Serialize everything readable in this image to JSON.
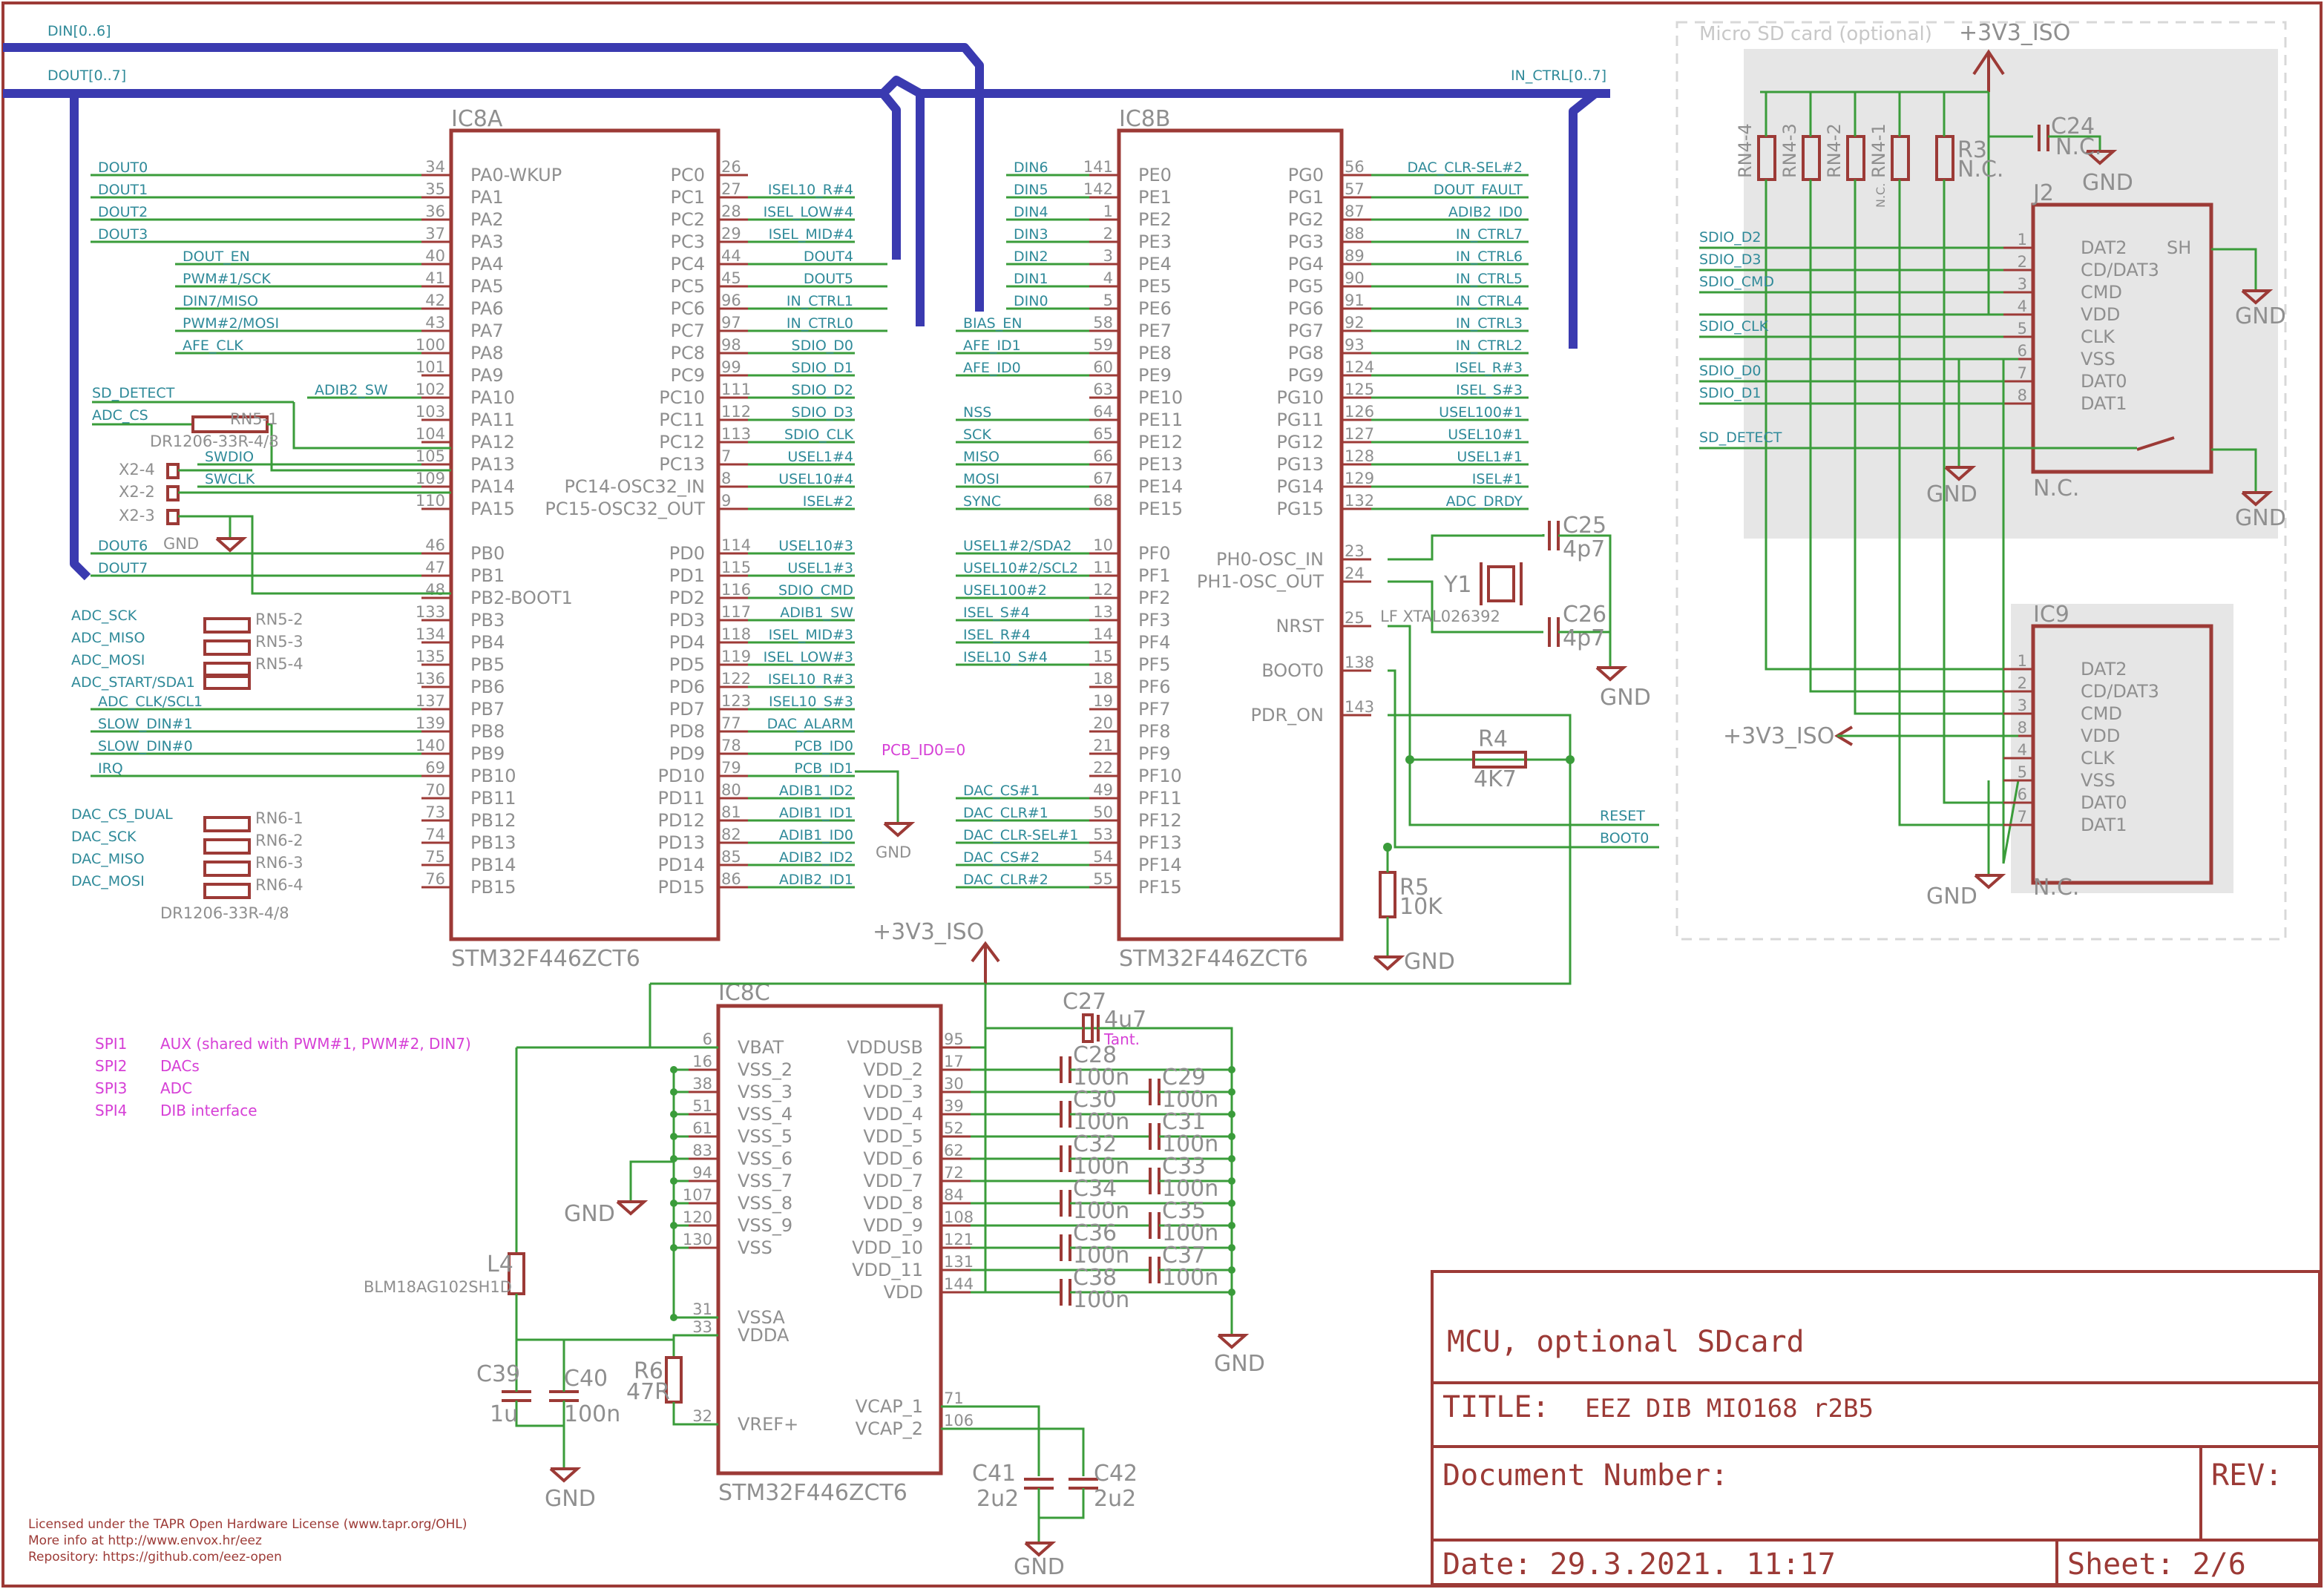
{
  "colors": {
    "frame": "#9c3a36",
    "wire": "#3a9c3a",
    "bus": "#3a3ab0",
    "signal": "#2f8a99",
    "label": "#8f8f8f",
    "note": "#d63fd6",
    "sdarea": "#e6e6e6"
  },
  "buses": {
    "din": "DIN[0..6]",
    "dout": "DOUT[0..7]",
    "in_ctrl": "IN_CTRL[0..7]"
  },
  "ic8a": {
    "name": "IC8A",
    "part": "STM32F446ZCT6",
    "left": [
      {
        "pin": "34",
        "name": "PA0-WKUP",
        "net": "DOUT0"
      },
      {
        "pin": "35",
        "name": "PA1",
        "net": "DOUT1"
      },
      {
        "pin": "36",
        "name": "PA2",
        "net": "DOUT2"
      },
      {
        "pin": "37",
        "name": "PA3",
        "net": "DOUT3"
      },
      {
        "pin": "40",
        "name": "PA4",
        "net": "DOUT_EN"
      },
      {
        "pin": "41",
        "name": "PA5",
        "net": "PWM#1/SCK"
      },
      {
        "pin": "42",
        "name": "PA6",
        "net": "DIN7/MISO"
      },
      {
        "pin": "43",
        "name": "PA7",
        "net": "PWM#2/MOSI"
      },
      {
        "pin": "100",
        "name": "PA8",
        "net": "AFE_CLK"
      },
      {
        "pin": "101",
        "name": "PA9",
        "net": ""
      },
      {
        "pin": "102",
        "name": "PA10",
        "net": "ADIB2_SW"
      },
      {
        "pin": "103",
        "name": "PA11",
        "net": ""
      },
      {
        "pin": "104",
        "name": "PA12",
        "net": ""
      },
      {
        "pin": "105",
        "name": "PA13",
        "net": "SWDIO"
      },
      {
        "pin": "109",
        "name": "PA14",
        "net": "SWCLK"
      },
      {
        "pin": "110",
        "name": "PA15",
        "net": ""
      },
      {
        "pin": "46",
        "name": "PB0",
        "net": "DOUT6"
      },
      {
        "pin": "47",
        "name": "PB1",
        "net": "DOUT7"
      },
      {
        "pin": "48",
        "name": "PB2-BOOT1",
        "net": ""
      },
      {
        "pin": "133",
        "name": "PB3",
        "net": ""
      },
      {
        "pin": "134",
        "name": "PB4",
        "net": ""
      },
      {
        "pin": "135",
        "name": "PB5",
        "net": ""
      },
      {
        "pin": "136",
        "name": "PB6",
        "net": ""
      },
      {
        "pin": "137",
        "name": "PB7",
        "net": "ADC_CLK/SCL1"
      },
      {
        "pin": "139",
        "name": "PB8",
        "net": "SLOW_DIN#1"
      },
      {
        "pin": "140",
        "name": "PB9",
        "net": "SLOW_DIN#0"
      },
      {
        "pin": "69",
        "name": "PB10",
        "net": "IRQ"
      },
      {
        "pin": "70",
        "name": "PB11",
        "net": ""
      },
      {
        "pin": "73",
        "name": "PB12",
        "net": ""
      },
      {
        "pin": "74",
        "name": "PB13",
        "net": ""
      },
      {
        "pin": "75",
        "name": "PB14",
        "net": ""
      },
      {
        "pin": "76",
        "name": "PB15",
        "net": ""
      }
    ],
    "right": [
      {
        "pin": "26",
        "name": "PC0",
        "net": ""
      },
      {
        "pin": "27",
        "name": "PC1",
        "net": "ISEL10_R#4"
      },
      {
        "pin": "28",
        "name": "PC2",
        "net": "ISEL_LOW#4"
      },
      {
        "pin": "29",
        "name": "PC3",
        "net": "ISEL_MID#4"
      },
      {
        "pin": "44",
        "name": "PC4",
        "net": "DOUT4"
      },
      {
        "pin": "45",
        "name": "PC5",
        "net": "DOUT5"
      },
      {
        "pin": "96",
        "name": "PC6",
        "net": "IN_CTRL1"
      },
      {
        "pin": "97",
        "name": "PC7",
        "net": "IN_CTRL0"
      },
      {
        "pin": "98",
        "name": "PC8",
        "net": "SDIO_D0"
      },
      {
        "pin": "99",
        "name": "PC9",
        "net": "SDIO_D1"
      },
      {
        "pin": "111",
        "name": "PC10",
        "net": "SDIO_D2"
      },
      {
        "pin": "112",
        "name": "PC11",
        "net": "SDIO_D3"
      },
      {
        "pin": "113",
        "name": "PC12",
        "net": "SDIO_CLK"
      },
      {
        "pin": "7",
        "name": "PC13",
        "net": "USEL1#4"
      },
      {
        "pin": "8",
        "name": "PC14-OSC32_IN",
        "net": "USEL10#4"
      },
      {
        "pin": "9",
        "name": "PC15-OSC32_OUT",
        "net": "ISEL#2"
      },
      {
        "pin": "114",
        "name": "PD0",
        "net": "USEL10#3"
      },
      {
        "pin": "115",
        "name": "PD1",
        "net": "USEL1#3"
      },
      {
        "pin": "116",
        "name": "PD2",
        "net": "SDIO_CMD"
      },
      {
        "pin": "117",
        "name": "PD3",
        "net": "ADIB1_SW"
      },
      {
        "pin": "118",
        "name": "PD4",
        "net": "ISEL_MID#3"
      },
      {
        "pin": "119",
        "name": "PD5",
        "net": "ISEL_LOW#3"
      },
      {
        "pin": "122",
        "name": "PD6",
        "net": "ISEL10_R#3"
      },
      {
        "pin": "123",
        "name": "PD7",
        "net": "ISEL10_S#3"
      },
      {
        "pin": "77",
        "name": "PD8",
        "net": "DAC_ALARM"
      },
      {
        "pin": "78",
        "name": "PD9",
        "net": "PCB_ID0"
      },
      {
        "pin": "79",
        "name": "PD10",
        "net": "PCB_ID1"
      },
      {
        "pin": "80",
        "name": "PD11",
        "net": "ADIB1_ID2"
      },
      {
        "pin": "81",
        "name": "PD12",
        "net": "ADIB1_ID1"
      },
      {
        "pin": "82",
        "name": "PD13",
        "net": "ADIB1_ID0"
      },
      {
        "pin": "85",
        "name": "PD14",
        "net": "ADIB2_ID2"
      },
      {
        "pin": "86",
        "name": "PD15",
        "net": "ADIB2_ID1"
      }
    ]
  },
  "ic8a_extra": {
    "sd_detect": "SD_DETECT",
    "adc_cs": "ADC_CS",
    "rn51": "RN5-1",
    "rn_part": "DR1206-33R-4/8",
    "x24": "X2-4",
    "x22": "X2-2",
    "x23": "X2-3",
    "gnd": "GND",
    "adc_sck": "ADC_SCK",
    "adc_miso": "ADC_MISO",
    "adc_mosi": "ADC_MOSI",
    "adc_start": "ADC_START/SDA1",
    "rn52": "RN5-2",
    "rn53": "RN5-3",
    "rn54": "RN5-4",
    "dac_cs": "DAC_CS_DUAL",
    "dac_sck": "DAC_SCK",
    "dac_miso": "DAC_MISO",
    "dac_mosi": "DAC_MOSI",
    "rn61": "RN6-1",
    "rn62": "RN6-2",
    "rn63": "RN6-3",
    "rn64": "RN6-4",
    "rn6_part": "DR1206-33R-4/8",
    "pcb_id0": "PCB_ID0=0"
  },
  "ic8b": {
    "name": "IC8B",
    "part": "STM32F446ZCT6",
    "left": [
      {
        "pin": "141",
        "name": "PE0",
        "net": "DIN6"
      },
      {
        "pin": "142",
        "name": "PE1",
        "net": "DIN5"
      },
      {
        "pin": "1",
        "name": "PE2",
        "net": "DIN4"
      },
      {
        "pin": "2",
        "name": "PE3",
        "net": "DIN3"
      },
      {
        "pin": "3",
        "name": "PE4",
        "net": "DIN2"
      },
      {
        "pin": "4",
        "name": "PE5",
        "net": "DIN1"
      },
      {
        "pin": "5",
        "name": "PE6",
        "net": "DIN0"
      },
      {
        "pin": "58",
        "name": "PE7",
        "net": "BIAS_EN"
      },
      {
        "pin": "59",
        "name": "PE8",
        "net": "AFE_ID1"
      },
      {
        "pin": "60",
        "name": "PE9",
        "net": "AFE_ID0"
      },
      {
        "pin": "63",
        "name": "PE10",
        "net": ""
      },
      {
        "pin": "64",
        "name": "PE11",
        "net": "NSS"
      },
      {
        "pin": "65",
        "name": "PE12",
        "net": "SCK"
      },
      {
        "pin": "66",
        "name": "PE13",
        "net": "MISO"
      },
      {
        "pin": "67",
        "name": "PE14",
        "net": "MOSI"
      },
      {
        "pin": "68",
        "name": "PE15",
        "net": "SYNC"
      },
      {
        "pin": "10",
        "name": "PF0",
        "net": "USEL1#2/SDA2"
      },
      {
        "pin": "11",
        "name": "PF1",
        "net": "USEL10#2/SCL2"
      },
      {
        "pin": "12",
        "name": "PF2",
        "net": "USEL100#2"
      },
      {
        "pin": "13",
        "name": "PF3",
        "net": "ISEL_S#4"
      },
      {
        "pin": "14",
        "name": "PF4",
        "net": "ISEL_R#4"
      },
      {
        "pin": "15",
        "name": "PF5",
        "net": "ISEL10_S#4"
      },
      {
        "pin": "18",
        "name": "PF6",
        "net": ""
      },
      {
        "pin": "19",
        "name": "PF7",
        "net": ""
      },
      {
        "pin": "20",
        "name": "PF8",
        "net": ""
      },
      {
        "pin": "21",
        "name": "PF9",
        "net": ""
      },
      {
        "pin": "22",
        "name": "PF10",
        "net": ""
      },
      {
        "pin": "49",
        "name": "PF11",
        "net": "DAC_CS#1"
      },
      {
        "pin": "50",
        "name": "PF12",
        "net": "DAC_CLR#1"
      },
      {
        "pin": "53",
        "name": "PF13",
        "net": "DAC_CLR-SEL#1"
      },
      {
        "pin": "54",
        "name": "PF14",
        "net": "DAC_CS#2"
      },
      {
        "pin": "55",
        "name": "PF15",
        "net": "DAC_CLR#2"
      }
    ],
    "right": [
      {
        "pin": "56",
        "name": "PG0",
        "net": "DAC_CLR-SEL#2"
      },
      {
        "pin": "57",
        "name": "PG1",
        "net": "DOUT_FAULT"
      },
      {
        "pin": "87",
        "name": "PG2",
        "net": "ADIB2_ID0"
      },
      {
        "pin": "88",
        "name": "PG3",
        "net": "IN_CTRL7"
      },
      {
        "pin": "89",
        "name": "PG4",
        "net": "IN_CTRL6"
      },
      {
        "pin": "90",
        "name": "PG5",
        "net": "IN_CTRL5"
      },
      {
        "pin": "91",
        "name": "PG6",
        "net": "IN_CTRL4"
      },
      {
        "pin": "92",
        "name": "PG7",
        "net": "IN_CTRL3"
      },
      {
        "pin": "93",
        "name": "PG8",
        "net": "IN_CTRL2"
      },
      {
        "pin": "124",
        "name": "PG9",
        "net": "ISEL_R#3"
      },
      {
        "pin": "125",
        "name": "PG10",
        "net": "ISEL_S#3"
      },
      {
        "pin": "126",
        "name": "PG11",
        "net": "USEL100#1"
      },
      {
        "pin": "127",
        "name": "PG12",
        "net": "USEL10#1"
      },
      {
        "pin": "128",
        "name": "PG13",
        "net": "USEL1#1"
      },
      {
        "pin": "129",
        "name": "PG14",
        "net": "ISEL#1"
      },
      {
        "pin": "132",
        "name": "PG15",
        "net": "ADC_DRDY"
      },
      {
        "pin": "23",
        "name": "PH0-OSC_IN",
        "net": ""
      },
      {
        "pin": "24",
        "name": "PH1-OSC_OUT",
        "net": ""
      },
      {
        "pin": "25",
        "name": "NRST",
        "net": ""
      },
      {
        "pin": "138",
        "name": "BOOT0",
        "net": ""
      },
      {
        "pin": "143",
        "name": "PDR_ON",
        "net": ""
      }
    ]
  },
  "ic8b_extra": {
    "c25": "C25",
    "c25v": "4p7",
    "c26": "C26",
    "c26v": "4p7",
    "y1": "Y1",
    "xtal": "LF XTAL026392",
    "gnd": "GND",
    "r4": "R4",
    "r4v": "4K7",
    "r5": "R5",
    "r5v": "10K",
    "reset": "RESET",
    "boot0": "BOOT0"
  },
  "ic8c": {
    "name": "IC8C",
    "part": "STM32F446ZCT6",
    "supply": "+3V3_ISO",
    "left": [
      {
        "pin": "6",
        "name": "VBAT"
      },
      {
        "pin": "16",
        "name": "VSS_2"
      },
      {
        "pin": "38",
        "name": "VSS_3"
      },
      {
        "pin": "51",
        "name": "VSS_4"
      },
      {
        "pin": "61",
        "name": "VSS_5"
      },
      {
        "pin": "83",
        "name": "VSS_6"
      },
      {
        "pin": "94",
        "name": "VSS_7"
      },
      {
        "pin": "107",
        "name": "VSS_8"
      },
      {
        "pin": "120",
        "name": "VSS_9"
      },
      {
        "pin": "130",
        "name": "VSS"
      },
      {
        "pin": "31",
        "name": "VSSA"
      },
      {
        "pin": "33",
        "name": "VDDA"
      },
      {
        "pin": "32",
        "name": "VREF+"
      }
    ],
    "right": [
      {
        "pin": "95",
        "name": "VDDUSB"
      },
      {
        "pin": "17",
        "name": "VDD_2"
      },
      {
        "pin": "30",
        "name": "VDD_3"
      },
      {
        "pin": "39",
        "name": "VDD_4"
      },
      {
        "pin": "52",
        "name": "VDD_5"
      },
      {
        "pin": "62",
        "name": "VDD_6"
      },
      {
        "pin": "72",
        "name": "VDD_7"
      },
      {
        "pin": "84",
        "name": "VDD_8"
      },
      {
        "pin": "108",
        "name": "VDD_9"
      },
      {
        "pin": "121",
        "name": "VDD_10"
      },
      {
        "pin": "131",
        "name": "VDD_11"
      },
      {
        "pin": "144",
        "name": "VDD"
      },
      {
        "pin": "71",
        "name": "VCAP_1"
      },
      {
        "pin": "106",
        "name": "VCAP_2"
      }
    ],
    "caps": [
      {
        "ref": "C28",
        "val": "100n"
      },
      {
        "ref": "C29",
        "val": "100n"
      },
      {
        "ref": "C30",
        "val": "100n"
      },
      {
        "ref": "C31",
        "val": "100n"
      },
      {
        "ref": "C32",
        "val": "100n"
      },
      {
        "ref": "C33",
        "val": "100n"
      },
      {
        "ref": "C34",
        "val": "100n"
      },
      {
        "ref": "C35",
        "val": "100n"
      },
      {
        "ref": "C36",
        "val": "100n"
      },
      {
        "ref": "C37",
        "val": "100n"
      },
      {
        "ref": "C38",
        "val": "100n"
      }
    ],
    "c27": "C27",
    "c27v": "4u7",
    "tant": "Tant.",
    "l4": "L4",
    "l4v": "BLM18AG102SH1D",
    "c39": "C39",
    "c39v": "1u",
    "c40": "C40",
    "c40v": "100n",
    "r6": "R6",
    "r6v": "47R",
    "c41": "C41",
    "c41v": "2u2",
    "c42": "C42",
    "c42v": "2u2",
    "gnd": "GND"
  },
  "notes": [
    {
      "bus": "SPI1",
      "desc": "AUX (shared with PWM#1, PWM#2, DIN7)"
    },
    {
      "bus": "SPI2",
      "desc": "DACs"
    },
    {
      "bus": "SPI3",
      "desc": "ADC"
    },
    {
      "bus": "SPI4",
      "desc": "DIB interface"
    }
  ],
  "license": [
    "Licensed under the TAPR Open Hardware License (www.tapr.org/OHL)",
    "More info at http://www.envox.hr/eez",
    "Repository: https://github.com/eez-open"
  ],
  "sd": {
    "title": "Micro SD card (optional)",
    "supply": "+3V3_ISO",
    "rn44": "RN4-4",
    "rn43": "RN4-3",
    "rn42": "RN4-2",
    "rn41": "RN4-1",
    "r3": "R3",
    "r3v": "N.C.",
    "nc": "N.C.",
    "c24": "C24",
    "c24v": "N.C.",
    "j2": "J2",
    "ic9": "IC9",
    "gnd": "GND",
    "nets": [
      "SDIO_D2",
      "SDIO_D3",
      "SDIO_CMD",
      "SDIO_CLK",
      "SDIO_D0",
      "SDIO_D1",
      "SD_DETECT"
    ],
    "j2pins": [
      {
        "pin": "1",
        "name": "DAT2"
      },
      {
        "pin": "2",
        "name": "CD/DAT3"
      },
      {
        "pin": "3",
        "name": "CMD"
      },
      {
        "pin": "4",
        "name": "VDD"
      },
      {
        "pin": "5",
        "name": "CLK"
      },
      {
        "pin": "6",
        "name": "VSS"
      },
      {
        "pin": "7",
        "name": "DAT0"
      },
      {
        "pin": "8",
        "name": "DAT1"
      }
    ],
    "sh": "SH",
    "ic9pins": [
      {
        "pin": "1",
        "name": "DAT2"
      },
      {
        "pin": "2",
        "name": "CD/DAT3"
      },
      {
        "pin": "3",
        "name": "CMD"
      },
      {
        "pin": "8",
        "name": "VDD"
      },
      {
        "pin": "4",
        "name": "CLK"
      },
      {
        "pin": "5",
        "name": "VSS"
      },
      {
        "pin": "6",
        "name": "DAT0"
      },
      {
        "pin": "7",
        "name": "DAT1"
      }
    ]
  },
  "titleblock": {
    "heading": "MCU, optional SDcard",
    "title_label": "TITLE:",
    "title": "EEZ DIB MIO168 r2B5",
    "docnum": "Document Number:",
    "rev": "REV:",
    "date": "Date: 29.3.2021. 11:17",
    "sheet": "Sheet: 2/6"
  }
}
